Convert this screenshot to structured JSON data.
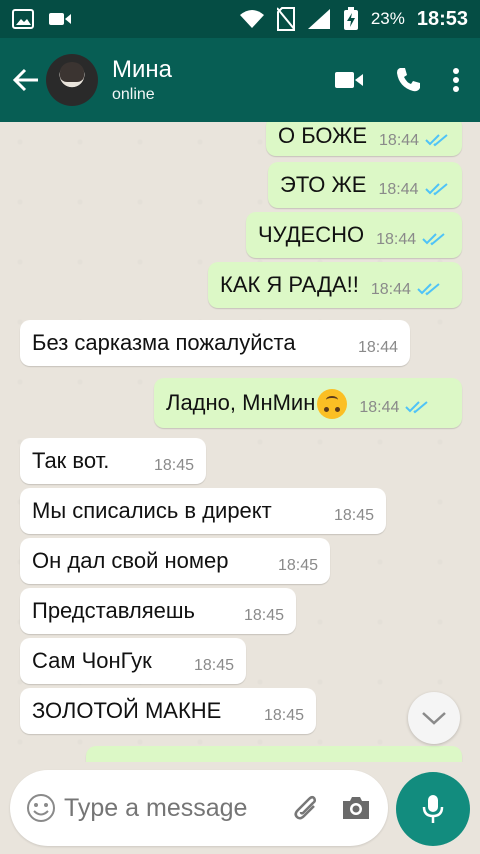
{
  "status_bar": {
    "battery": "23%",
    "time": "18:53"
  },
  "chat": {
    "name": "Мина",
    "status": "online",
    "messages": [
      {
        "text": "О БОЖЕ",
        "time": "18:44",
        "dir": "out"
      },
      {
        "text": "ЭТО ЖЕ",
        "time": "18:44",
        "dir": "out"
      },
      {
        "text": "ЧУДЕСНО",
        "time": "18:44",
        "dir": "out"
      },
      {
        "text": "КАК Я РАДА!!",
        "time": "18:44",
        "dir": "out"
      },
      {
        "text": "Без сарказма пожалуйста",
        "time": "18:44",
        "dir": "in"
      },
      {
        "text": "Ладно, МнМин",
        "time": "18:44",
        "dir": "out"
      },
      {
        "text": "Так вот.",
        "time": "18:45",
        "dir": "in"
      },
      {
        "text": "Мы списались в директ",
        "time": "18:45",
        "dir": "in"
      },
      {
        "text": "Он дал свой номер",
        "time": "18:45",
        "dir": "in"
      },
      {
        "text": "Представляешь",
        "time": "18:45",
        "dir": "in"
      },
      {
        "text": "Сам ЧонГук",
        "time": "18:45",
        "dir": "in"
      },
      {
        "text": "ЗОЛОТОЙ МАКНЕ",
        "time": "18:45",
        "dir": "in"
      }
    ]
  },
  "composer": {
    "placeholder": "Type a message"
  },
  "colors": {
    "header": "#075e54",
    "outgoing": "#dcf8c6",
    "accent": "#128c7e"
  }
}
